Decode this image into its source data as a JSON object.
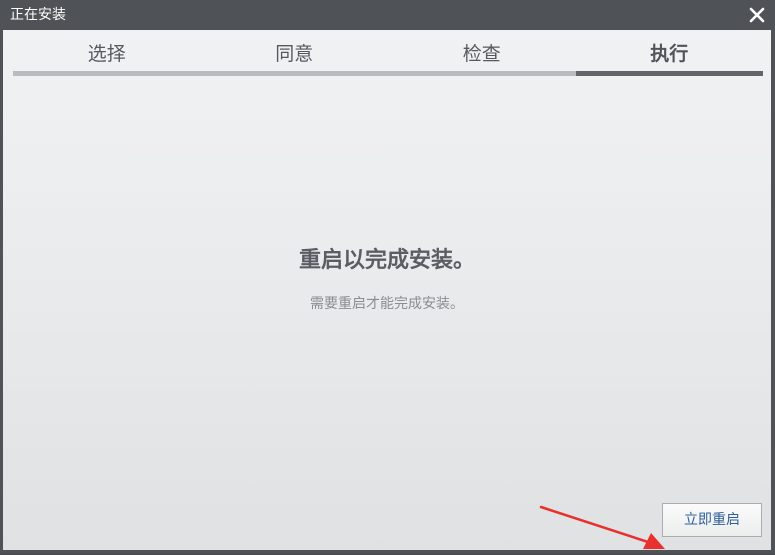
{
  "window": {
    "title": "正在安装",
    "close_icon": "close-icon"
  },
  "steps": [
    {
      "label": "选择",
      "active": false
    },
    {
      "label": "同意",
      "active": false
    },
    {
      "label": "检查",
      "active": false
    },
    {
      "label": "执行",
      "active": true
    }
  ],
  "main": {
    "heading": "重启以完成安装。",
    "subtext": "需要重启才能完成安装。"
  },
  "footer": {
    "restart_button_label": "立即重启"
  },
  "colors": {
    "titlebar": "#4f5257",
    "active_step_bar": "#62666b",
    "inactive_step_bar": "#b9bbbe",
    "button_text": "#2f5f9a",
    "annotation_arrow": "#e8302c"
  }
}
